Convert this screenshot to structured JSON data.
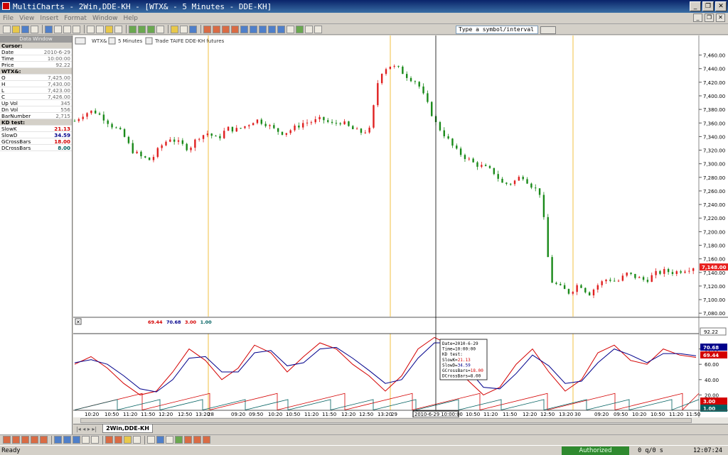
{
  "window": {
    "title": "MultiCharts - 2Win,DDE-KH - [WTX& - 5 Minutes - DDE-KH]"
  },
  "menu": [
    "File",
    "View",
    "Insert",
    "Format",
    "Window",
    "Help"
  ],
  "toolbar": {
    "symbol_placeholder": "Type a symbol/interval"
  },
  "data_window": {
    "title": "Data Window",
    "rows": [
      {
        "label": "Cursor:",
        "value": "",
        "section": true
      },
      {
        "label": "Date",
        "value": "2010-6-29"
      },
      {
        "label": "Time",
        "value": "10:00:00"
      },
      {
        "label": "Price",
        "value": "92.22"
      },
      {
        "label": "WTX&:",
        "value": "",
        "section": true
      },
      {
        "label": "O",
        "value": "7,425.00"
      },
      {
        "label": "H",
        "value": "7,430.00"
      },
      {
        "label": "L",
        "value": "7,423.00"
      },
      {
        "label": "C",
        "value": "7,426.00"
      },
      {
        "label": "Up Vol",
        "value": "345"
      },
      {
        "label": "Dn Vol",
        "value": "556"
      },
      {
        "label": "BarNumber",
        "value": "2,715"
      },
      {
        "label": "KD test:",
        "value": "",
        "section": true
      },
      {
        "label": "SlowK",
        "value": "21.13",
        "color": "#d40000"
      },
      {
        "label": "SlowD",
        "value": "34.59",
        "color": "#00008b"
      },
      {
        "label": "GCrossBars",
        "value": "18.00",
        "color": "#d40000"
      },
      {
        "label": "DCrossBars",
        "value": "8.00",
        "color": "#006060"
      }
    ]
  },
  "chart_header": {
    "symbol": "WTX&",
    "interval": "5 Minutes",
    "description": "Trade  TAIFE DDE-KH futures"
  },
  "indicator_header": {
    "values": [
      "69.44",
      "70.68",
      "3.00",
      "1.00"
    ],
    "colors": [
      "#d40000",
      "#00008b",
      "#d40000",
      "#006060"
    ]
  },
  "price_axis": {
    "labels": [
      "7,460.00",
      "7,440.00",
      "7,420.00",
      "7,400.00",
      "7,380.00",
      "7,360.00",
      "7,340.00",
      "7,320.00",
      "7,300.00",
      "7,280.00",
      "7,260.00",
      "7,240.00",
      "7,220.00",
      "7,200.00",
      "7,180.00",
      "7,160.00",
      "7,140.00",
      "7,120.00",
      "7,100.00",
      "7,080.00"
    ],
    "last_price": "7,148.00",
    "last_price_color": "#e8201e"
  },
  "indicator_axis": {
    "labels": [
      "80.00",
      "60.00",
      "40.00",
      "20.00"
    ],
    "cursor_value": "92.22",
    "tags": [
      {
        "text": "70.68",
        "color": "#00008b"
      },
      {
        "text": "69.44",
        "color": "#d40000"
      },
      {
        "text": "3.00",
        "color": "#d40000"
      },
      {
        "text": "1.00",
        "color": "#006060"
      }
    ]
  },
  "time_axis": {
    "labels": [
      "10:20",
      "10:50",
      "11:20",
      "11:50",
      "12:20",
      "12:50",
      "13:20",
      "28",
      "09:20",
      "09:50",
      "10:20",
      "10:50",
      "11:20",
      "11:50",
      "12:20",
      "12:50",
      "13:20",
      "29",
      "10:50",
      "11:20",
      "11:50",
      "12:20",
      "12:50",
      "13:20",
      "30",
      "09:20",
      "09:50",
      "10:20",
      "10:50",
      "11:20",
      "11:50"
    ],
    "cursor_label": "2010-6-29 10:00:00"
  },
  "tooltip": {
    "lines": [
      "Date=2010-6-29",
      "Time=10:00:00",
      "KD test:",
      "SlowK=21.13",
      "SlowD=34.59",
      "GCrossBars=18.00",
      "DCrossBars=8.00"
    ]
  },
  "sheet_tab": "2Win,DDE-KH",
  "status": {
    "ready": "Ready",
    "authorized": "Authorized",
    "queue": "0 q/0 s",
    "clock": "12:07:24"
  },
  "chart_data": {
    "type": "candlestick",
    "symbol": "WTX&",
    "interval": "5 Minutes",
    "ylim": [
      7075,
      7470
    ],
    "session_breaks": [
      "28",
      "29",
      "30"
    ],
    "close_path": [
      7363,
      7374,
      7378,
      7368,
      7355,
      7345,
      7320,
      7310,
      7305,
      7325,
      7338,
      7330,
      7322,
      7340,
      7345,
      7336,
      7352,
      7350,
      7356,
      7365,
      7360,
      7350,
      7345,
      7352,
      7360,
      7362,
      7366,
      7358,
      7362,
      7352,
      7346,
      7350,
      7432,
      7445,
      7440,
      7428,
      7420,
      7390,
      7358,
      7340,
      7320,
      7310,
      7300,
      7295,
      7288,
      7270,
      7272,
      7283,
      7268,
      7255,
      7128,
      7118,
      7110,
      7124,
      7108,
      7122,
      7131,
      7126,
      7138,
      7133,
      7128,
      7138,
      7142,
      7140,
      7144,
      7148
    ],
    "last_price": 7148,
    "indicator": {
      "name": "KD test",
      "ylim": [
        0,
        100
      ],
      "series": [
        {
          "name": "SlowK",
          "color": "#d40000",
          "current": 69.44,
          "values": [
            60,
            70,
            55,
            35,
            20,
            25,
            50,
            80,
            65,
            40,
            55,
            85,
            75,
            50,
            70,
            88,
            80,
            60,
            45,
            25,
            45,
            80,
            95,
            85,
            40,
            20,
            30,
            60,
            80,
            50,
            25,
            40,
            75,
            85,
            65,
            60,
            80,
            72,
            69
          ]
        },
        {
          "name": "SlowD",
          "color": "#00008b",
          "current": 70.68,
          "values": [
            62,
            66,
            60,
            45,
            28,
            24,
            40,
            68,
            70,
            50,
            50,
            75,
            78,
            58,
            62,
            80,
            82,
            68,
            52,
            35,
            40,
            68,
            88,
            88,
            55,
            30,
            28,
            48,
            72,
            58,
            35,
            38,
            62,
            80,
            72,
            62,
            74,
            74,
            71
          ]
        },
        {
          "name": "GCrossBars",
          "color": "#d40000",
          "current": 3.0
        },
        {
          "name": "DCrossBars",
          "color": "#006060",
          "current": 1.0
        }
      ]
    }
  }
}
